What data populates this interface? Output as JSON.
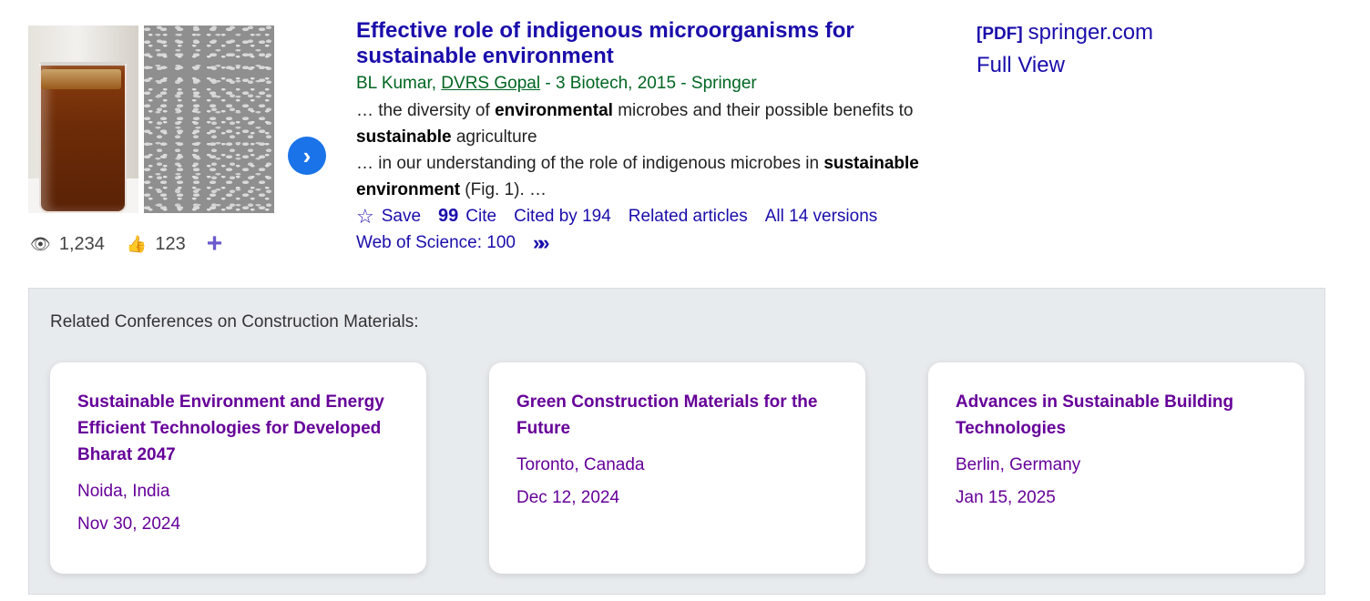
{
  "result": {
    "title_part1": "Effective role of indigenous microorganisms for",
    "title_part2": "sustainable environment",
    "authors": {
      "author1": "BL Kumar,",
      "author2": "DVRS Gopal",
      "rest": "- 3 Biotech, 2015 - Springer"
    },
    "snippet": [
      {
        "a": "… the diversity of ",
        "b": "environmental",
        "c": " microbes and their possible benefits to"
      },
      {
        "a": "",
        "b": "sustainable",
        "c": " agriculture"
      },
      {
        "a": "… in our understanding of the role of indigenous microbes in ",
        "b": "sustainable",
        "c": ""
      },
      {
        "a": "",
        "b": "environment",
        "c": " (Fig. 1). …"
      }
    ],
    "actions": {
      "save": "Save",
      "cite": "Cite",
      "cited_by": "Cited by 194",
      "related": "Related articles",
      "versions": "All 14 versions",
      "wos": "Web of Science: 100"
    },
    "stats": {
      "views": "1,234",
      "likes": "123"
    },
    "side": {
      "pdf_tag": "[PDF]",
      "domain": "springer.com",
      "full_view": "Full View"
    },
    "icons": {
      "star": "star-outline-icon",
      "cite": "quote-icon",
      "more": "double-chevron-icon",
      "eye": "eye-icon",
      "thumb": "thumbs-up-icon",
      "plus": "plus-icon",
      "next": "chevron-right-icon"
    }
  },
  "conferences": {
    "heading": "Related Conferences on Construction Materials:",
    "cards": [
      {
        "title": "Sustainable Environment and Energy Efficient Technologies for Developed Bharat 2047",
        "location": "Noida, India",
        "date": "Nov 30, 2024"
      },
      {
        "title": "Green Construction Materials for the Future",
        "location": "Toronto, Canada",
        "date": "Dec 12, 2024"
      },
      {
        "title": "Advances in Sustainable Building Technologies",
        "location": "Berlin, Germany",
        "date": "Jan 15, 2025"
      }
    ]
  },
  "colors": {
    "link": "#1a0dab",
    "authors": "#006621",
    "card_text": "#660099",
    "panel_bg": "#e8ebee",
    "next_button": "#1a73e8",
    "plus": "#6a5acd"
  }
}
